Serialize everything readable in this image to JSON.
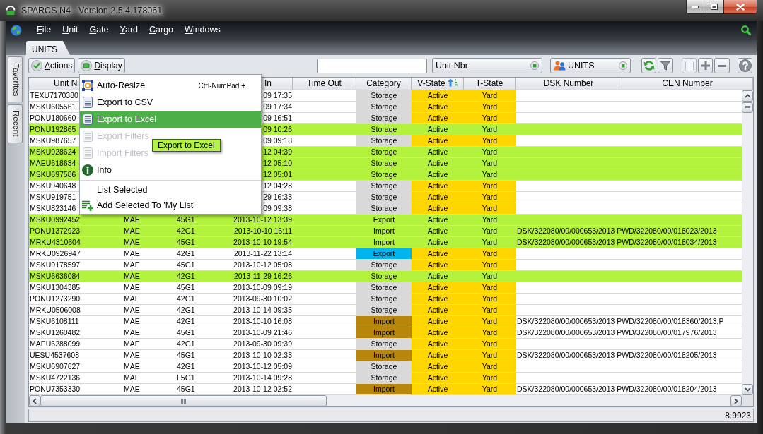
{
  "window": {
    "title": "SPARCS N4 - Version 2.5.4.178061"
  },
  "menu_bar": [
    "File",
    "Unit",
    "Gate",
    "Yard",
    "Cargo",
    "Windows"
  ],
  "tabs": [
    {
      "label": "UNITS",
      "selected": true
    }
  ],
  "side_tabs": [
    {
      "label": "Favorites"
    },
    {
      "label": "Recent"
    }
  ],
  "toolbar": {
    "buttons": [
      {
        "label": "Actions",
        "kind": "check"
      },
      {
        "label": "Display",
        "kind": "display"
      }
    ],
    "field_selector": {
      "value": "Unit Nbr"
    },
    "entity_selector": {
      "value": "UNITS"
    },
    "icon_buttons": [
      {
        "kind": "refresh",
        "disabled": false
      },
      {
        "kind": "filter",
        "disabled": false
      },
      {
        "kind": "clipboard",
        "disabled": true
      },
      {
        "kind": "add",
        "disabled": false
      },
      {
        "kind": "remove",
        "disabled": false
      },
      {
        "kind": "help",
        "disabled": false
      }
    ]
  },
  "table": {
    "columns": [
      {
        "label": "Unit N"
      },
      {
        "label": "In"
      },
      {
        "label": "Time Out"
      },
      {
        "label": "Category"
      },
      {
        "label": "V-State",
        "sorted": true
      },
      {
        "label": "T-State"
      },
      {
        "label": "DSK Number"
      },
      {
        "label": "CEN Number"
      }
    ],
    "rows": [
      {
        "column_1": "TEXU7170380",
        "column_4": "09 17:35",
        "category": {
          "text": "Storage",
          "color": "#d9d9d9"
        },
        "v_state": "Active",
        "t_state": "Yard",
        "selected": false
      },
      {
        "column_1": "MSKU605561",
        "column_4": "09 17:34",
        "category": {
          "text": "Storage",
          "color": "#d9d9d9"
        },
        "v_state": "Active",
        "t_state": "Yard",
        "selected": false
      },
      {
        "column_1": "PONU180660",
        "column_4": "09 16:51",
        "category": {
          "text": "Storage",
          "color": "#d9d9d9"
        },
        "v_state": "Active",
        "t_state": "Yard",
        "selected": false
      },
      {
        "column_1": "PONU192865",
        "column_4": "09 10:26",
        "category": {
          "text": "Storage"
        },
        "v_state": "Active",
        "t_state": "Yard",
        "selected": true
      },
      {
        "column_1": "MSKU987657",
        "column_4": "09 09:18",
        "category": {
          "text": "Storage",
          "color": "#d9d9d9"
        },
        "v_state": "Active",
        "t_state": "Yard",
        "selected": false
      },
      {
        "column_1": "MSKU928624",
        "column_4": "12 04:39",
        "category": {
          "text": "Storage"
        },
        "v_state": "Active",
        "t_state": "Yard",
        "selected": true
      },
      {
        "column_1": "MAEU618634",
        "column_4": "12 05:10",
        "category": {
          "text": "Storage"
        },
        "v_state": "Active",
        "t_state": "Yard",
        "selected": true
      },
      {
        "column_1": "MSKU697586",
        "column_4": "12 05:01",
        "category": {
          "text": "Storage"
        },
        "v_state": "Active",
        "t_state": "Yard",
        "selected": true
      },
      {
        "column_1": "MSKU940648",
        "column_4": "12 04:28",
        "category": {
          "text": "Storage",
          "color": "#d9d9d9"
        },
        "v_state": "Active",
        "t_state": "Yard",
        "selected": false
      },
      {
        "column_1": "MSKU919751",
        "column_4": "29 16:33",
        "category": {
          "text": "Storage",
          "color": "#d9d9d9"
        },
        "v_state": "Active",
        "t_state": "Yard",
        "selected": false
      },
      {
        "column_1": "MSKU823146",
        "column_4": "09 09:38",
        "category": {
          "text": "Storage",
          "color": "#d9d9d9"
        },
        "v_state": "Active",
        "t_state": "Yard",
        "selected": false
      },
      {
        "column_1": "MSKU0992452",
        "column_2": "MAE",
        "column_3": "45G1",
        "column_4": "2013-10-12 13:39",
        "category": {
          "text": "Export"
        },
        "v_state": "Active",
        "t_state": "Yard",
        "selected": true
      },
      {
        "column_1": "PONU1372923",
        "column_2": "MAE",
        "column_3": "42G1",
        "column_4": "2013-10-10 16:11",
        "category": {
          "text": "Import"
        },
        "v_state": "Active",
        "t_state": "Yard",
        "dsk_number": "DSK/322080/00/000653/2013 PWD/322080/00/018023/2013",
        "selected": true
      },
      {
        "column_1": "MRKU4310604",
        "column_2": "MAE",
        "column_3": "45G1",
        "column_4": "2013-10-10 19:54",
        "category": {
          "text": "Import"
        },
        "v_state": "Active",
        "t_state": "Yard",
        "dsk_number": "DSK/322080/00/000653/2013 PWD/322080/00/018034/2013",
        "selected": true
      },
      {
        "column_1": "MRKU0926947",
        "column_2": "MAE",
        "column_3": "42G1",
        "column_4": "2013-11-22 13:14",
        "category": {
          "text": "Export",
          "color": "#00b4f0"
        },
        "v_state": "Active",
        "t_state": "Yard",
        "selected": false
      },
      {
        "column_1": "MSKU9178597",
        "column_2": "MAE",
        "column_3": "45G1",
        "column_4": "2013-10-12 05:08",
        "category": {
          "text": "Storage",
          "color": "#d9d9d9"
        },
        "v_state": "Active",
        "t_state": "Yard",
        "selected": false
      },
      {
        "column_1": "MSKU6636084",
        "column_2": "MAE",
        "column_3": "42G1",
        "column_4": "2013-11-29 16:26",
        "category": {
          "text": "Storage"
        },
        "v_state": "Active",
        "t_state": "Yard",
        "selected": true
      },
      {
        "column_1": "MSKU1304385",
        "column_2": "MAE",
        "column_3": "45G1",
        "column_4": "2013-10-09 09:19",
        "category": {
          "text": "Storage",
          "color": "#d9d9d9"
        },
        "v_state": "Active",
        "t_state": "Yard",
        "selected": false
      },
      {
        "column_1": "PONU1273290",
        "column_2": "MAE",
        "column_3": "42G1",
        "column_4": "2013-09-30 10:02",
        "category": {
          "text": "Storage",
          "color": "#d9d9d9"
        },
        "v_state": "Active",
        "t_state": "Yard",
        "selected": false
      },
      {
        "column_1": "MRKU0506008",
        "column_2": "MAE",
        "column_3": "42G1",
        "column_4": "2013-10-14 09:35",
        "category": {
          "text": "Storage",
          "color": "#d9d9d9"
        },
        "v_state": "Active",
        "t_state": "Yard",
        "selected": false
      },
      {
        "column_1": "MSKU6108111",
        "column_2": "MAE",
        "column_3": "42G1",
        "column_4": "2013-10-10 16:08",
        "category": {
          "text": "Import",
          "color": "#b8860b"
        },
        "v_state": "Active",
        "t_state": "Yard",
        "dsk_number": "DSK/322080/00/000653/2013 PWD/322080/00/018360/2013,P",
        "selected": false
      },
      {
        "column_1": "MSKU1260482",
        "column_2": "MAE",
        "column_3": "45G1",
        "column_4": "2013-10-09 21:46",
        "category": {
          "text": "Import",
          "color": "#b8860b"
        },
        "v_state": "Active",
        "t_state": "Yard",
        "dsk_number": "DSK/322080/00/000653/2013 PWD/322080/00/017976/2013",
        "selected": false
      },
      {
        "column_1": "MAEU6288099",
        "column_2": "MAE",
        "column_3": "42G1",
        "column_4": "2013-09-30 09:39",
        "category": {
          "text": "Storage",
          "color": "#d9d9d9"
        },
        "v_state": "Active",
        "t_state": "Yard",
        "selected": false
      },
      {
        "column_1": "UESU4537608",
        "column_2": "MAE",
        "column_3": "45G1",
        "column_4": "2013-10-10 02:33",
        "category": {
          "text": "Import",
          "color": "#b8860b"
        },
        "v_state": "Active",
        "t_state": "Yard",
        "dsk_number": "DSK/322080/00/000653/2013 PWD/322080/00/018205/2013",
        "selected": false
      },
      {
        "column_1": "MSKU6907627",
        "column_2": "MAE",
        "column_3": "42G1",
        "column_4": "2013-10-12 05:09",
        "category": {
          "text": "Storage",
          "color": "#d9d9d9"
        },
        "v_state": "Active",
        "t_state": "Yard",
        "selected": false
      },
      {
        "column_1": "MSKU4722136",
        "column_2": "MAE",
        "column_3": "L5G1",
        "column_4": "2013-10-14 09:28",
        "category": {
          "text": "Storage",
          "color": "#d9d9d9"
        },
        "v_state": "Active",
        "t_state": "Yard",
        "selected": false
      },
      {
        "column_1": "PONU7353330",
        "column_2": "MAE",
        "column_3": "45G1",
        "column_4": "2013-10-12 02:52",
        "category": {
          "text": "Import",
          "color": "#b8860b"
        },
        "v_state": "Active",
        "t_state": "Yard",
        "dsk_number": "DSK/322080/00/000653/2013 PWD/322080/00/018204/2013",
        "selected": false
      }
    ]
  },
  "context_menu": {
    "items": [
      {
        "kind": "resize",
        "label": "Auto-Resize",
        "shortcut": "Ctrl-NumPad +",
        "selected": false,
        "disabled": false
      },
      {
        "kind": "document",
        "label": "Export to CSV",
        "selected": false,
        "disabled": false
      },
      {
        "kind": "document",
        "label": "Export to Excel",
        "selected": true,
        "disabled": false
      },
      {
        "kind": "document",
        "label": "Export Filters",
        "selected": false,
        "disabled": true
      },
      {
        "kind": "document",
        "label": "Import Filters",
        "selected": false,
        "disabled": true
      },
      {
        "kind": "info",
        "label": "Info",
        "selected": false,
        "disabled": false
      },
      {
        "kind": "separator"
      },
      {
        "kind": "plain",
        "label": "List Selected",
        "selected": false,
        "disabled": false
      },
      {
        "kind": "add-list",
        "label": "Add Selected To 'My List'",
        "selected": false,
        "disabled": false
      }
    ]
  },
  "tooltip": {
    "text": "Export to Excel"
  },
  "status_bar": {
    "text": "8:9923"
  }
}
